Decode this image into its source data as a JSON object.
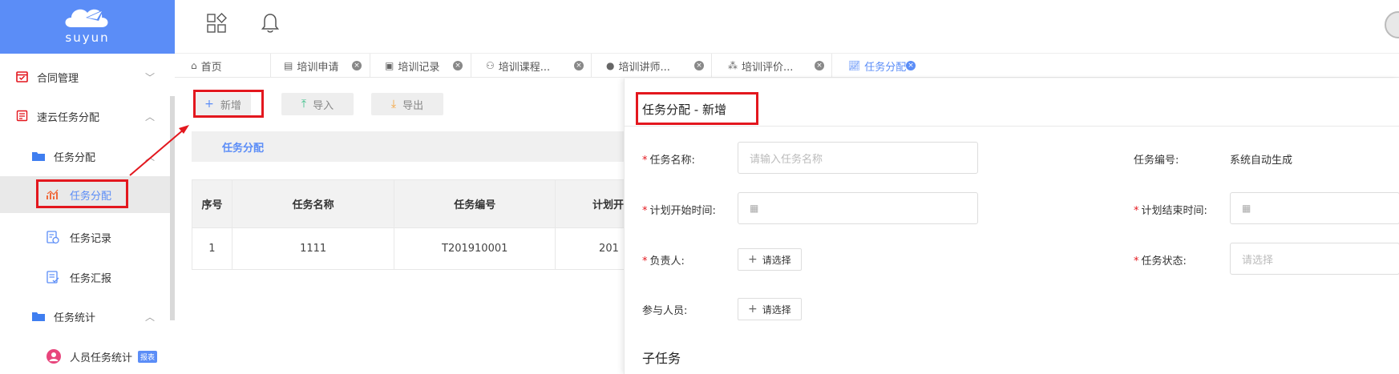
{
  "brand": {
    "name": "suyun"
  },
  "sidebar": {
    "items": [
      {
        "label": "合同管理",
        "icon": "calendar-check-icon",
        "arrow": "﹀"
      },
      {
        "label": "速云任务分配",
        "icon": "document-list-icon",
        "arrow": "︿"
      },
      {
        "label": "任务分配",
        "icon": "folder-icon",
        "arrow": "︿"
      },
      {
        "label": "任务分配",
        "icon": "chart-icon",
        "active": true
      },
      {
        "label": "任务记录",
        "icon": "record-icon"
      },
      {
        "label": "任务汇报",
        "icon": "report-icon"
      },
      {
        "label": "任务统计",
        "icon": "folder-icon",
        "arrow": "︿"
      },
      {
        "label": "人员任务统计",
        "icon": "user-icon",
        "badge": "报表"
      }
    ]
  },
  "header": {
    "icons": [
      "apps-icon",
      "bell-icon"
    ]
  },
  "tabs": [
    {
      "label": "首页",
      "icon": "home-icon"
    },
    {
      "label": "培训申请",
      "icon": "form-icon",
      "close": "×"
    },
    {
      "label": "培训记录",
      "icon": "list-icon",
      "close": "×"
    },
    {
      "label": "培训课程...",
      "icon": "course-icon",
      "close": "×"
    },
    {
      "label": "培训讲师...",
      "icon": "teacher-icon",
      "close": "×"
    },
    {
      "label": "培训评价...",
      "icon": "rating-icon",
      "close": "×"
    },
    {
      "label": "任务分配",
      "icon": "chart-icon",
      "close": "×",
      "active": true
    }
  ],
  "toolbar": {
    "add_label": "新增",
    "import_label": "导入",
    "export_label": "导出"
  },
  "list": {
    "title": "任务分配",
    "columns": [
      "序号",
      "任务名称",
      "任务编号",
      "计划开"
    ],
    "rows": [
      [
        "1",
        "1111",
        "T201910001",
        "201"
      ]
    ]
  },
  "drawer": {
    "title": "任务分配 - 新增",
    "fields": {
      "task_name_label": "任务名称:",
      "task_name_placeholder": "请输入任务名称",
      "task_no_label": "任务编号:",
      "task_no_value": "系统自动生成",
      "start_label": "计划开始时间:",
      "end_label": "计划结束时间:",
      "owner_label": "负责人:",
      "owner_button": "请选择",
      "status_label": "任务状态:",
      "status_placeholder": "请选择",
      "participants_label": "参与人员:",
      "participants_button": "请选择",
      "required_mark": "*"
    },
    "subtask_title": "子任务"
  },
  "colors": {
    "accent": "#5b8df7",
    "annotation": "#e3171e"
  }
}
